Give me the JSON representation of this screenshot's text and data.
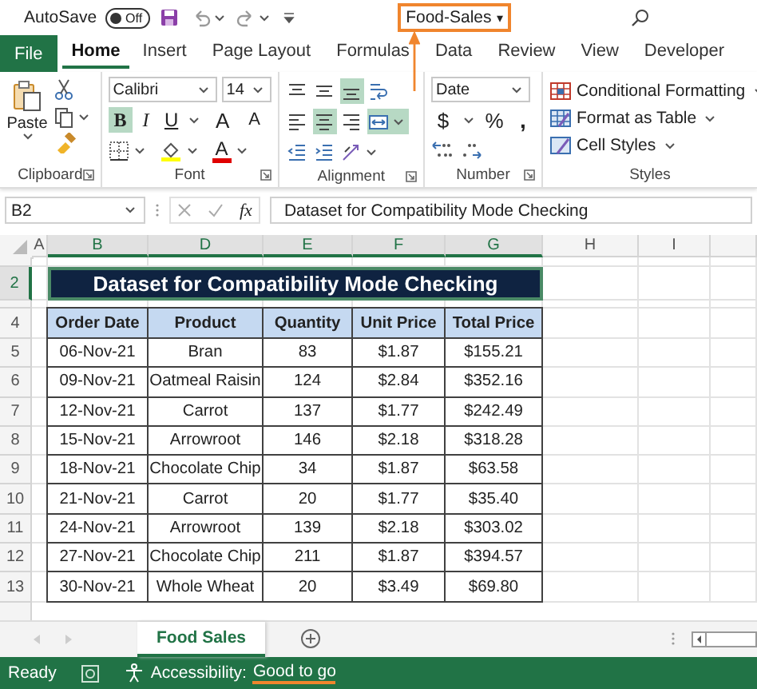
{
  "title_bar": {
    "autosave_label": "AutoSave",
    "autosave": {
      "label": "Off",
      "on": false
    },
    "file_name": "Food-Sales",
    "file_caret": "▾"
  },
  "ribbon_tabs": [
    {
      "label": "File",
      "kind": "file",
      "selected": false
    },
    {
      "label": "Home",
      "kind": "tab",
      "selected": true
    },
    {
      "label": "Insert",
      "kind": "tab",
      "selected": false
    },
    {
      "label": "Page Layout",
      "kind": "tab",
      "selected": false
    },
    {
      "label": "Formulas",
      "kind": "tab",
      "selected": false
    },
    {
      "label": "Data",
      "kind": "tab",
      "selected": false
    },
    {
      "label": "Review",
      "kind": "tab",
      "selected": false
    },
    {
      "label": "View",
      "kind": "tab",
      "selected": false
    },
    {
      "label": "Developer",
      "kind": "tab",
      "selected": false
    }
  ],
  "clipboard": {
    "paste_label": "Paste",
    "group_label": "Clipboard"
  },
  "font": {
    "font_name": "Calibri",
    "font_size": "14",
    "group_label": "Font",
    "font_color_label": "A",
    "buttons": [
      {
        "label": "B",
        "kind": "bold",
        "selected": true
      },
      {
        "label": "I",
        "kind": "italic",
        "selected": false
      },
      {
        "label": "U",
        "kind": "underline",
        "selected": false
      },
      {
        "label": "A",
        "kind": "grow",
        "selected": false
      },
      {
        "label": "A",
        "kind": "shrink",
        "selected": false
      }
    ]
  },
  "alignment": {
    "group_label": "Alignment",
    "buttons": [
      {
        "kind": "align_top",
        "selected": false
      },
      {
        "kind": "align_middle",
        "selected": false
      },
      {
        "kind": "align_bottom",
        "selected": true
      },
      {
        "kind": "wrap",
        "selected": false
      },
      {
        "kind": "left",
        "selected": false
      },
      {
        "kind": "center",
        "selected": true
      },
      {
        "kind": "right",
        "selected": false
      },
      {
        "kind": "merge",
        "selected": true
      },
      {
        "kind": "indent_decrease",
        "selected": false
      },
      {
        "kind": "indent_increase",
        "selected": false
      },
      {
        "kind": "orientation",
        "selected": false
      }
    ]
  },
  "number": {
    "format": "Date",
    "group_label": "Number",
    "buttons": [
      {
        "label": "$",
        "kind": "currency"
      },
      {
        "label": "%",
        "kind": "percent"
      },
      {
        "label": ",",
        "kind": "comma"
      }
    ]
  },
  "styles": {
    "group_label": "Styles",
    "items": [
      {
        "label": "Conditional Formatting",
        "kind": "conditional"
      },
      {
        "label": "Format as Table",
        "kind": "table"
      },
      {
        "label": "Cell Styles",
        "kind": "cell_styles"
      }
    ]
  },
  "formula_bar": {
    "name_box": "B2",
    "function_label": "fx",
    "formula": "Dataset for Compatibility Mode Checking"
  },
  "sheet": {
    "columns": [
      {
        "label": "A",
        "selected": false
      },
      {
        "label": "B",
        "selected": true
      },
      {
        "label": "D",
        "selected": true
      },
      {
        "label": "E",
        "selected": true
      },
      {
        "label": "F",
        "selected": true
      },
      {
        "label": "G",
        "selected": true
      },
      {
        "label": "H",
        "selected": false
      },
      {
        "label": "I",
        "selected": false
      }
    ],
    "rows": [
      {
        "kind": "thin",
        "selected": false
      },
      {
        "kind": "title",
        "label": "2",
        "selected": true
      },
      {
        "kind": "thin",
        "selected": false
      },
      {
        "kind": "header",
        "label": "4",
        "selected": false
      },
      {
        "kind": "data",
        "label": "5",
        "selected": false
      },
      {
        "kind": "data",
        "label": "6",
        "selected": false
      },
      {
        "kind": "data",
        "label": "7",
        "selected": false
      },
      {
        "kind": "data",
        "label": "8",
        "selected": false
      },
      {
        "kind": "data",
        "label": "9",
        "selected": false
      },
      {
        "kind": "data",
        "label": "10",
        "selected": false
      },
      {
        "kind": "data",
        "label": "11",
        "selected": false
      },
      {
        "kind": "data",
        "label": "12",
        "selected": false
      },
      {
        "kind": "data",
        "label": "13",
        "selected": false
      }
    ],
    "title": "Dataset for Compatibility Mode Checking",
    "table": {
      "columns": [
        "Order Date",
        "Product",
        "Quantity",
        "Unit Price",
        "Total Price"
      ],
      "rows": [
        [
          "06-Nov-21",
          "Bran",
          "83",
          "$1.87",
          "$155.21"
        ],
        [
          "09-Nov-21",
          "Oatmeal Raisin",
          "124",
          "$2.84",
          "$352.16"
        ],
        [
          "12-Nov-21",
          "Carrot",
          "137",
          "$1.77",
          "$242.49"
        ],
        [
          "15-Nov-21",
          "Arrowroot",
          "146",
          "$2.18",
          "$318.28"
        ],
        [
          "18-Nov-21",
          "Chocolate Chip",
          "34",
          "$1.87",
          "$63.58"
        ],
        [
          "21-Nov-21",
          "Carrot",
          "20",
          "$1.77",
          "$35.40"
        ],
        [
          "24-Nov-21",
          "Arrowroot",
          "139",
          "$2.18",
          "$303.02"
        ],
        [
          "27-Nov-21",
          "Chocolate Chip",
          "211",
          "$1.87",
          "$394.57"
        ],
        [
          "30-Nov-21",
          "Whole Wheat",
          "20",
          "$3.49",
          "$69.80"
        ]
      ]
    }
  },
  "sheet_tabs": [
    {
      "label": "Food Sales",
      "selected": true
    }
  ],
  "status_bar": {
    "ready": "Ready",
    "accessibility_label": "Accessibility:",
    "accessibility_status": "Good to go"
  }
}
